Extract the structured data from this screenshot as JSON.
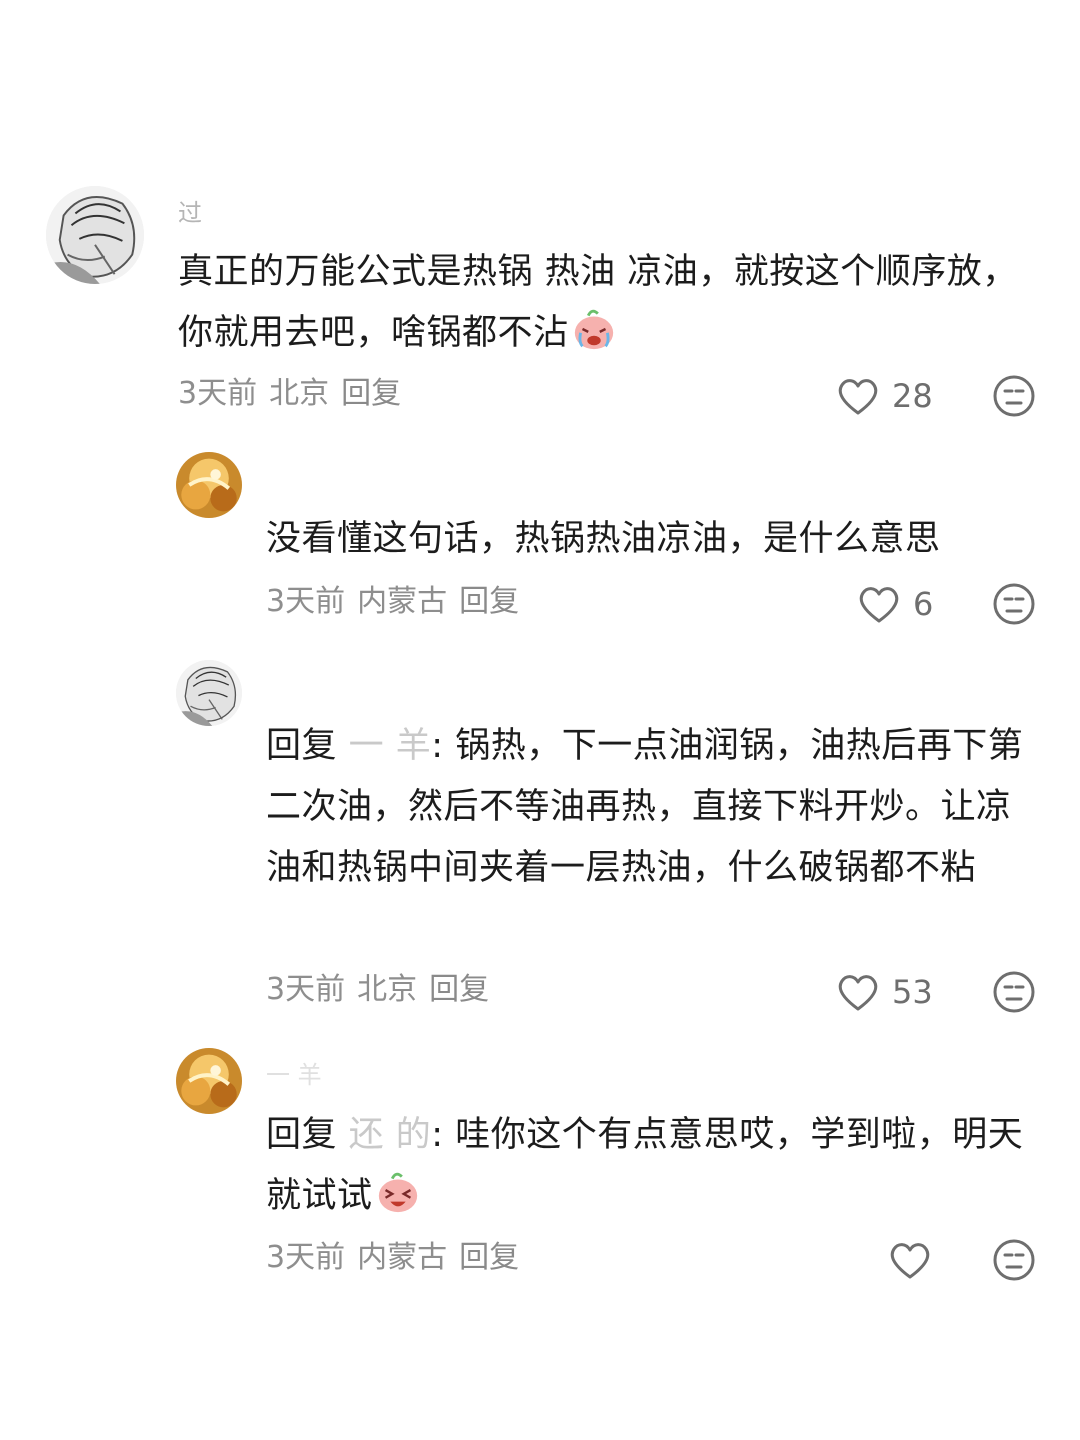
{
  "comments": [
    {
      "username": "过",
      "text": "真正的万能公式是热锅 热油 凉油，就按这个顺序放，你就用去吧，啥锅都不沾",
      "emoji": "crying-face-emoji",
      "time": "3天前",
      "location": "北京",
      "reply_label": "回复",
      "likes": "28"
    },
    {
      "username": "",
      "text": "没看懂这句话，热锅热油凉油，是什么意思",
      "time": "3天前",
      "location": "内蒙古",
      "reply_label": "回复",
      "likes": "6"
    },
    {
      "username": "",
      "reply_prefix": "回复",
      "reply_target": "一 羊",
      "text": ": 锅热，下一点油润锅，油热后再下第二次油，然后不等油再热，直接下料开炒。让凉油和热锅中间夹着一层热油，什么破锅都不粘",
      "time": "3天前",
      "location": "北京",
      "reply_label": "回复",
      "likes": "53"
    },
    {
      "username": "一 羊",
      "reply_prefix": "回复",
      "reply_target": "还 的",
      "text": ": 哇你这个有点意思哎，学到啦，明天就试试",
      "emoji": "laughing-face-emoji",
      "time": "3天前",
      "location": "内蒙古",
      "reply_label": "回复",
      "likes": ""
    }
  ],
  "colors": {
    "text": "#1c1c1c",
    "meta": "#8e8e8e",
    "icon": "#6e6e6e",
    "emoji_pink": "#f4a7a7"
  },
  "icons": [
    "heart-outline-icon",
    "dislike-face-icon",
    "avatar-sketch",
    "avatar-anime"
  ]
}
